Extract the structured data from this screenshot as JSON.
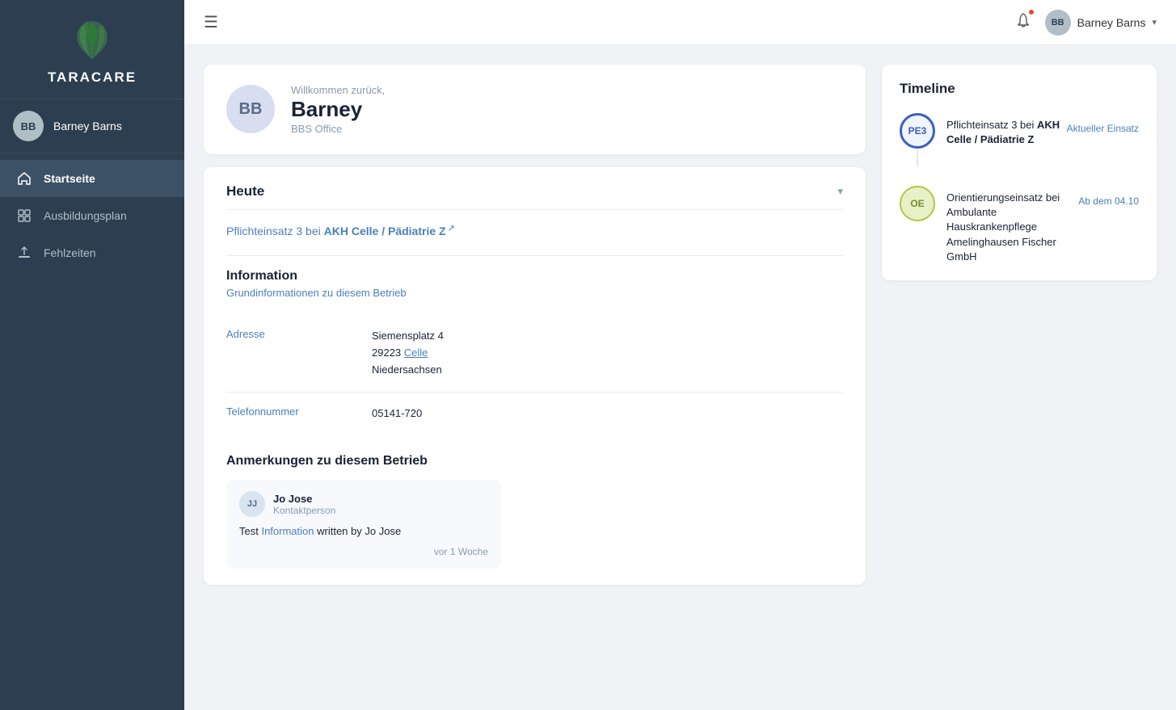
{
  "sidebar": {
    "logo_text": "TaraCare",
    "user": {
      "initials": "BB",
      "name": "Barney Barns"
    },
    "nav": [
      {
        "id": "startseite",
        "label": "Startseite",
        "icon": "home",
        "active": true
      },
      {
        "id": "ausbildungsplan",
        "label": "Ausbildungsplan",
        "icon": "grid",
        "active": false
      },
      {
        "id": "fehlzeiten",
        "label": "Fehlzeiten",
        "icon": "upload",
        "active": false
      }
    ]
  },
  "topbar": {
    "menu_icon": "☰",
    "user": {
      "initials": "BB",
      "name": "Barney Barns"
    },
    "chevron": "▾"
  },
  "welcome": {
    "greeting": "Willkommen zurück,",
    "name": "Barney",
    "office": "BBS Office",
    "initials": "BB"
  },
  "heute": {
    "title": "Heute",
    "link_prefix": "Pflichteinsatz 3 bei ",
    "link_bold": "AKH Celle / Pädiatrie Z",
    "ext_icon": "↗"
  },
  "information": {
    "title": "Information",
    "subtitle": "Grundinformationen zu diesem Betrieb",
    "rows": [
      {
        "label": "Adresse",
        "value_line1": "Siemensplatz 4",
        "value_line2": "29223 ",
        "value_link": "Celle",
        "value_line3": "Niedersachsen"
      },
      {
        "label": "Telefonnummer",
        "value": "05141-720"
      }
    ]
  },
  "anmerkungen": {
    "title": "Anmerkungen zu diesem Betrieb",
    "comment": {
      "initials": "JJ",
      "name": "Jo Jose",
      "role": "Kontaktperson",
      "text_prefix": "Test ",
      "text_link": "Information",
      "text_suffix": " written by Jo Jose",
      "time": "vor 1 Woche"
    }
  },
  "timeline": {
    "title": "Timeline",
    "items": [
      {
        "badge": "PE3",
        "badge_class": "pe3",
        "main_text_prefix": "Pflichteinsatz 3 bei ",
        "main_text_bold": "AKH Celle / Pädiatrie Z",
        "status": "Aktueller Einsatz"
      },
      {
        "badge": "OE",
        "badge_class": "oe",
        "main_text_prefix": "Orientierungseinsatz bei Ambulante Hauskrankenpflege Amelinghausen Fischer GmbH",
        "main_text_bold": "",
        "status": "Ab dem 04.10"
      }
    ]
  }
}
